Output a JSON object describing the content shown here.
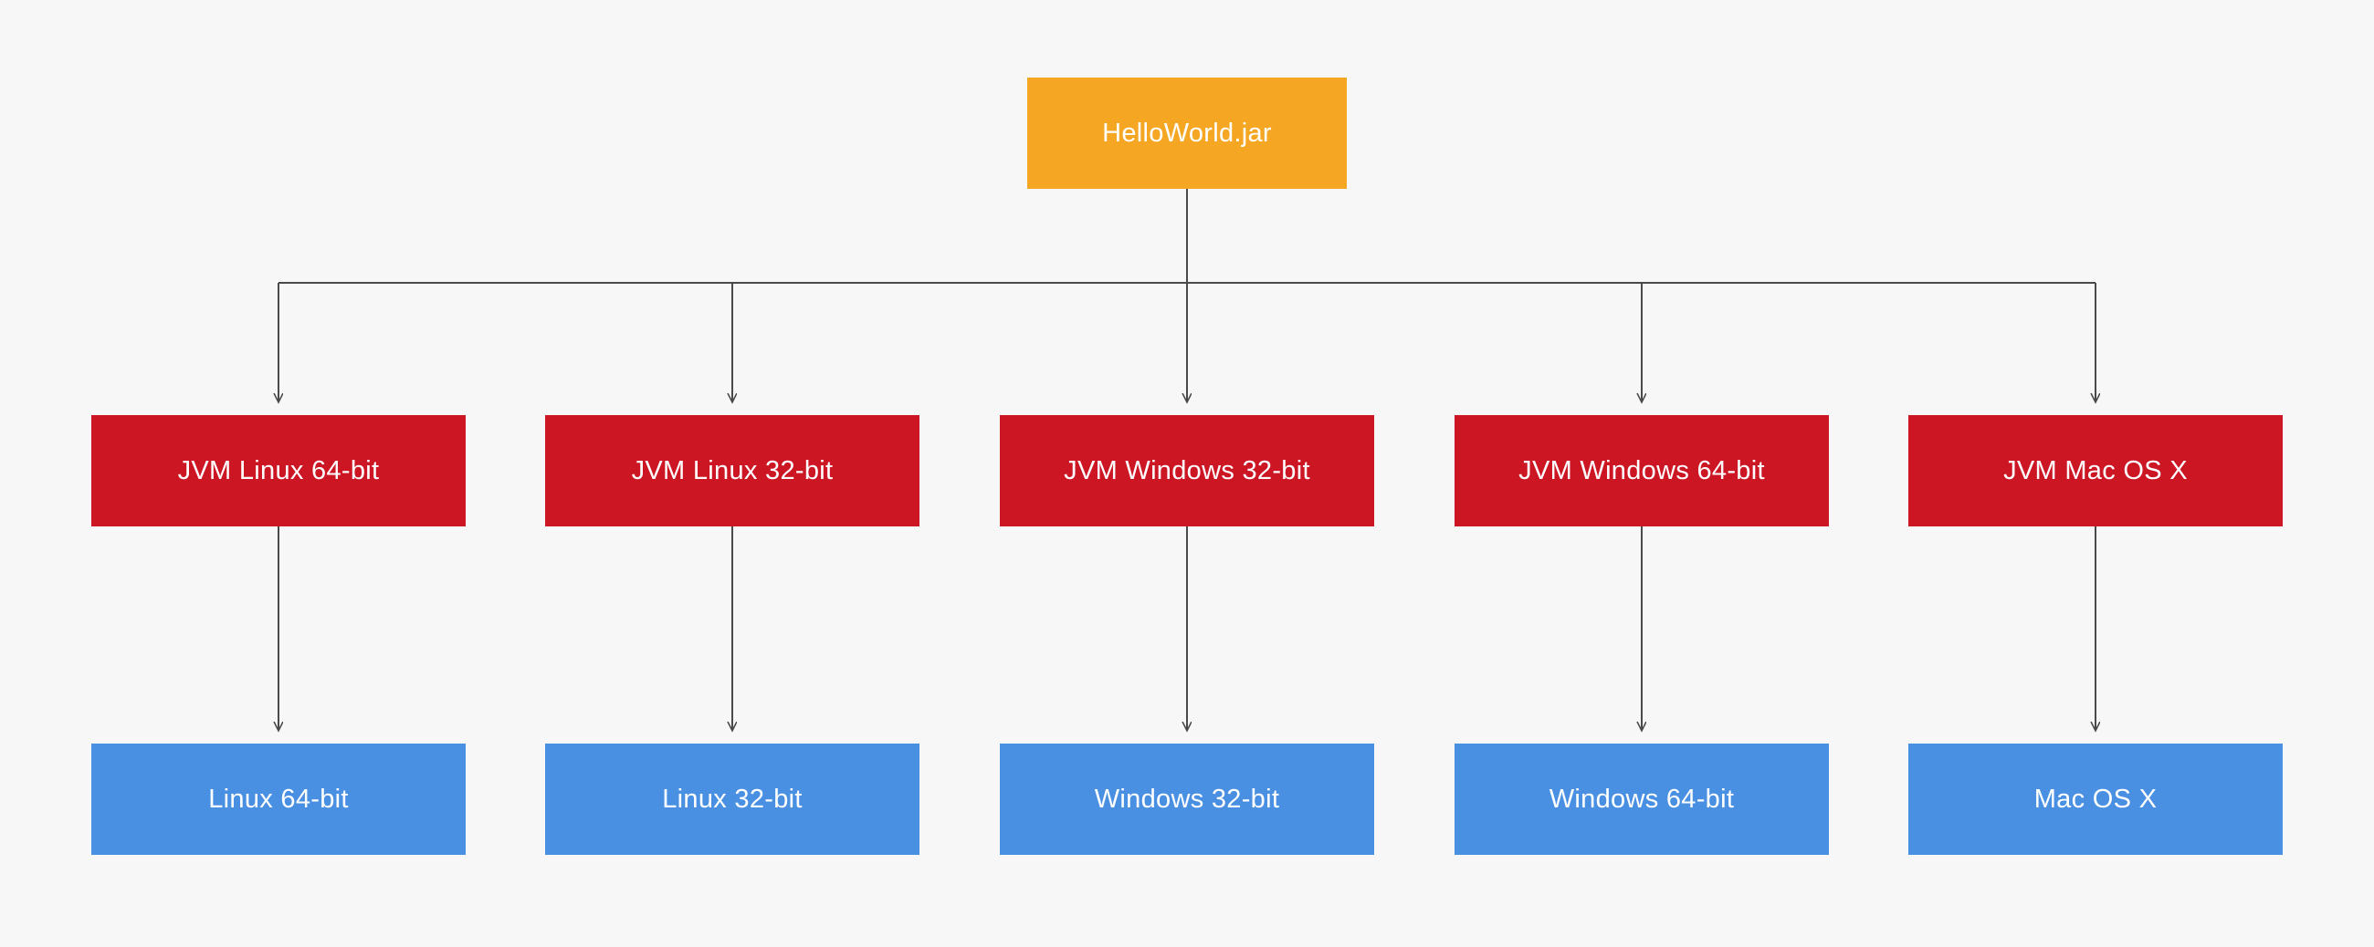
{
  "root": {
    "label": "HelloWorld.jar"
  },
  "jvms": [
    {
      "label": "JVM Linux 64-bit"
    },
    {
      "label": "JVM Linux 32-bit"
    },
    {
      "label": "JVM Windows 32-bit"
    },
    {
      "label": "JVM Windows 64-bit"
    },
    {
      "label": "JVM Mac OS X"
    }
  ],
  "oses": [
    {
      "label": "Linux 64-bit"
    },
    {
      "label": "Linux 32-bit"
    },
    {
      "label": "Windows 32-bit"
    },
    {
      "label": "Windows 64-bit"
    },
    {
      "label": "Mac OS X"
    }
  ],
  "colors": {
    "root": "#f5a623",
    "jvm": "#cc1624",
    "os": "#4a90e2",
    "arrow": "#4a4a4a",
    "bg": "#f7f7f7"
  }
}
